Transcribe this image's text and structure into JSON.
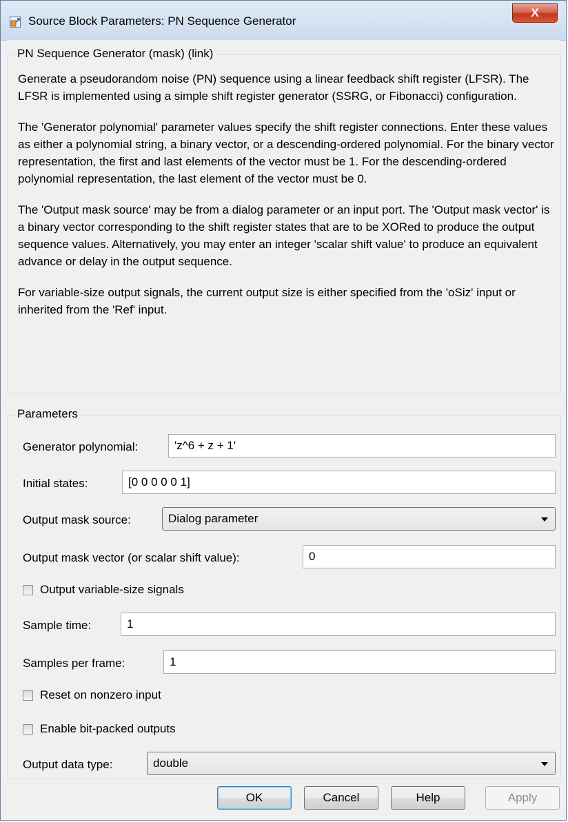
{
  "window": {
    "title": "Source Block Parameters: PN Sequence Generator",
    "close_label": "X"
  },
  "description": {
    "legend": "PN Sequence Generator (mask) (link)",
    "paragraphs": [
      "Generate a pseudorandom noise (PN) sequence using a linear feedback shift register (LFSR). The LFSR is implemented using a simple shift register generator (SSRG, or Fibonacci) configuration.",
      "The 'Generator polynomial' parameter values specify the shift register connections. Enter these values as either a polynomial string, a binary vector, or a descending-ordered polynomial. For the binary vector representation, the first and last elements of the vector must be 1. For the descending-ordered polynomial representation, the last element of the vector must be 0.",
      "The 'Output mask source' may be from a dialog parameter or an input port. The 'Output mask vector' is a binary vector corresponding to the shift register states that are to be XORed to produce the output sequence values. Alternatively, you may enter an integer 'scalar shift value' to produce an equivalent advance or delay in the output sequence.",
      "For variable-size output signals, the current output size is either specified from the 'oSiz' input or inherited from the 'Ref' input."
    ]
  },
  "parameters": {
    "legend": "Parameters",
    "generator_polynomial": {
      "label": "Generator polynomial:",
      "value": "'z^6 + z + 1'"
    },
    "initial_states": {
      "label": "Initial states:",
      "value": "[0 0 0 0 0 1]"
    },
    "output_mask_source": {
      "label": "Output mask source:",
      "value": "Dialog parameter"
    },
    "output_mask_vector": {
      "label": "Output mask vector (or scalar shift value):",
      "value": "0"
    },
    "output_variable_size": {
      "label": "Output variable-size signals",
      "checked": false
    },
    "sample_time": {
      "label": "Sample time:",
      "value": "1"
    },
    "samples_per_frame": {
      "label": "Samples per frame:",
      "value": "1"
    },
    "reset_on_nonzero": {
      "label": "Reset on nonzero input",
      "checked": false
    },
    "bit_packed": {
      "label": "Enable bit-packed outputs",
      "checked": false
    },
    "output_data_type": {
      "label": "Output data type:",
      "value": "double"
    }
  },
  "buttons": {
    "ok": "OK",
    "cancel": "Cancel",
    "help": "Help",
    "apply": "Apply"
  },
  "colors": {
    "titlebar": "#d6e3f2",
    "close_button": "#c0361c",
    "background": "#f0f0f0"
  }
}
